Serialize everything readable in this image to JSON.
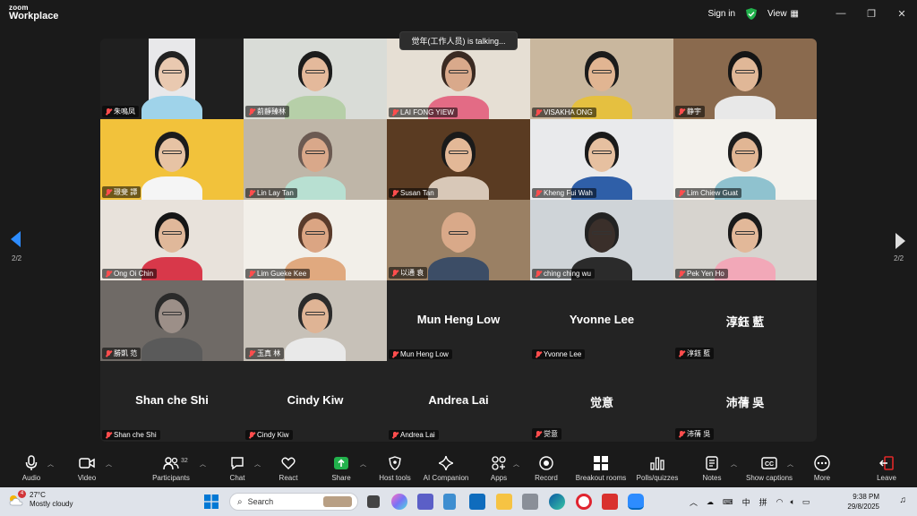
{
  "titlebar": {
    "logo_line1": "zoom",
    "logo_line2": "Workplace",
    "sign_in": "Sign in",
    "view": "View",
    "view_icon": "grid-icon",
    "controls": [
      "—",
      "❐",
      "✕"
    ]
  },
  "talking_indicator": "觉年(工作人员) is talking...",
  "pagination": {
    "left": "2/2",
    "right": "2/2"
  },
  "participants": [
    {
      "name": "朱鳴凤",
      "type": "video",
      "bg": "#1f1f1f",
      "skin": "#e9c9b0",
      "hair": "#222",
      "shirt": "#9fd3ea",
      "photo_bg": "#e8e8ea",
      "narrow": true
    },
    {
      "name": "莂靜臻林",
      "type": "video",
      "bg": "#d9dcd7",
      "skin": "#e4b99b",
      "hair": "#1c1c1c",
      "shirt": "#b6cfa8"
    },
    {
      "name": "LAI FONG YIEW",
      "type": "video",
      "bg": "#e6dfd4",
      "skin": "#d9a98b",
      "hair": "#3a2a22",
      "shirt": "#e36b85"
    },
    {
      "name": "VISAKHA ONG",
      "type": "video",
      "bg": "#c9b79e",
      "skin": "#e1b592",
      "hair": "#1b1b1b",
      "shirt": "#e5c040"
    },
    {
      "name": "静宇",
      "type": "video",
      "bg": "#8a6a4e",
      "skin": "#e0b797",
      "hair": "#151515",
      "shirt": "#e8e8e8"
    },
    {
      "name": "璟斐 譚",
      "type": "video",
      "bg": "#f2c23b",
      "skin": "#e7c3a4",
      "hair": "#1c1c1c",
      "shirt": "#f5f5f5"
    },
    {
      "name": "Lin Lay Tan",
      "type": "video",
      "bg": "#bfb6a8",
      "skin": "#d9a88a",
      "hair": "#6b5a52",
      "shirt": "#b8e0d2"
    },
    {
      "name": "Susan Tan",
      "type": "video",
      "bg": "#5a3b22",
      "skin": "#e3b897",
      "hair": "#1a1a1a",
      "shirt": "#d8c8b8"
    },
    {
      "name": "Kheng Fui Wah",
      "type": "video",
      "bg": "#e9eaec",
      "skin": "#e6c0a0",
      "hair": "#1a1a1a",
      "shirt": "#2f5fa8"
    },
    {
      "name": "Lim Chiew Guat",
      "type": "video",
      "bg": "#f3f1ec",
      "skin": "#e1b694",
      "hair": "#1d1d1d",
      "shirt": "#8fc2cf"
    },
    {
      "name": "Ong Oi Chin",
      "type": "video",
      "bg": "#e8e2db",
      "skin": "#e0b89a",
      "hair": "#151515",
      "shirt": "#d8384a"
    },
    {
      "name": "Lim Gueke Kee",
      "type": "video",
      "bg": "#f2efe9",
      "skin": "#dba583",
      "hair": "#5a3b2b",
      "shirt": "#e0a97f"
    },
    {
      "name": "以通 袁",
      "type": "video",
      "bg": "#9a8064",
      "skin": "#d9a989",
      "hair": "#d9a989",
      "shirt": "#3c4d66"
    },
    {
      "name": "ching ching wu",
      "type": "video",
      "bg": "#cfd4d8",
      "skin": "#3a2f2a",
      "hair": "#222",
      "shirt": "#2b2b2b"
    },
    {
      "name": "Pek Yen Ho",
      "type": "video",
      "bg": "#d7d4cf",
      "skin": "#e2b899",
      "hair": "#1a1a1a",
      "shirt": "#f2a8b8"
    },
    {
      "name": "勝凱 范",
      "type": "video",
      "bg": "#6f6a66",
      "skin": "#9c8f88",
      "hair": "#2a2a2a",
      "shirt": "#5a5a5a"
    },
    {
      "name": "玉真 林",
      "type": "video",
      "bg": "#c7c1b8",
      "skin": "#dfb495",
      "hair": "#2b2b2b",
      "shirt": "#e9e9e9"
    },
    {
      "name": "Mun Heng Low",
      "type": "name"
    },
    {
      "name": "Yvonne Lee",
      "type": "name"
    },
    {
      "name": "淳鈺 藍",
      "type": "name"
    },
    {
      "name": "Shan che Shi",
      "type": "name"
    },
    {
      "name": "Cindy Kiw",
      "type": "name"
    },
    {
      "name": "Andrea Lai",
      "type": "name"
    },
    {
      "name": "觉意",
      "type": "name"
    },
    {
      "name": "沛蒨 吳",
      "type": "name"
    }
  ],
  "toolbar": {
    "audio": "Audio",
    "video": "Video",
    "participants": "Participants",
    "participants_count": "32",
    "chat": "Chat",
    "react": "React",
    "share": "Share",
    "host_tools": "Host tools",
    "ai_companion": "AI Companion",
    "apps": "Apps",
    "record": "Record",
    "breakout": "Breakout rooms",
    "polls": "Polls/quizzes",
    "notes": "Notes",
    "captions": "Show captions",
    "more": "More",
    "leave": "Leave"
  },
  "taskbar": {
    "badge": "4",
    "temp": "27°C",
    "condition": "Mostly cloudy",
    "search_placeholder": "Search",
    "lang1": "中",
    "lang2": "拼",
    "time": "9:38 PM",
    "date": "29/8/2025"
  }
}
